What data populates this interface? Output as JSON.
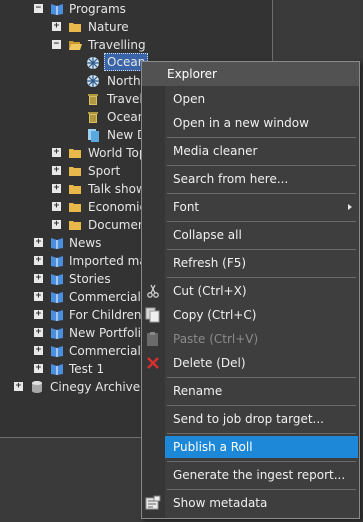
{
  "tree": [
    {
      "label": "Programs",
      "icon": "book-icon",
      "expander": "−"
    },
    {
      "label": "Nature",
      "icon": "folder-icon",
      "expander": "+"
    },
    {
      "label": "Travelling",
      "icon": "folder-open-icon",
      "expander": "−"
    },
    {
      "label": "Ocean",
      "icon": "snowflake-icon",
      "selected": true
    },
    {
      "label": "North",
      "icon": "snowflake-icon"
    },
    {
      "label": "Travel",
      "icon": "trash-icon"
    },
    {
      "label": "Ocean",
      "icon": "trash-icon"
    },
    {
      "label": "New D",
      "icon": "document-icon"
    },
    {
      "label": "World Top",
      "icon": "folder-icon",
      "expander": "+"
    },
    {
      "label": "Sport",
      "icon": "folder-icon",
      "expander": "+"
    },
    {
      "label": "Talk show",
      "icon": "folder-icon",
      "expander": "+"
    },
    {
      "label": "Economic",
      "icon": "folder-icon",
      "expander": "+"
    },
    {
      "label": "Documen",
      "icon": "folder-icon",
      "expander": "+"
    },
    {
      "label": "News",
      "icon": "book-icon",
      "expander": "+"
    },
    {
      "label": "Imported mat",
      "icon": "book-icon",
      "expander": "+"
    },
    {
      "label": "Stories",
      "icon": "book-icon",
      "expander": "+"
    },
    {
      "label": "Commercials",
      "icon": "book-icon",
      "expander": "+"
    },
    {
      "label": "For Children",
      "icon": "book-icon",
      "expander": "+"
    },
    {
      "label": "New Portfoli",
      "icon": "book-icon",
      "expander": "+"
    },
    {
      "label": "Commercial a",
      "icon": "book-icon",
      "expander": "+"
    },
    {
      "label": "Test 1",
      "icon": "book-icon",
      "expander": "+"
    },
    {
      "label": "Cinegy Archive :",
      "icon": "database-icon",
      "expander": "+"
    }
  ],
  "menu": {
    "header": "Explorer",
    "items": [
      {
        "label": "Open"
      },
      {
        "label": "Open in a new window"
      },
      {
        "label": "Media cleaner"
      },
      {
        "label": "Search from here..."
      },
      {
        "label": "Font"
      },
      {
        "label": "Collapse all"
      },
      {
        "label": "Refresh (F5)"
      },
      {
        "label": "Cut (Ctrl+X)"
      },
      {
        "label": "Copy (Ctrl+C)"
      },
      {
        "label": "Paste (Ctrl+V)"
      },
      {
        "label": "Delete (Del)"
      },
      {
        "label": "Rename"
      },
      {
        "label": "Send to job drop target..."
      },
      {
        "label": "Publish a Roll"
      },
      {
        "label": "Generate the ingest report..."
      },
      {
        "label": "Show metadata"
      }
    ]
  },
  "colors": {
    "highlight": "#1e88d8",
    "selection": "#3a64a8",
    "book": "#4a8ee0",
    "folder": "#e8b84a"
  }
}
